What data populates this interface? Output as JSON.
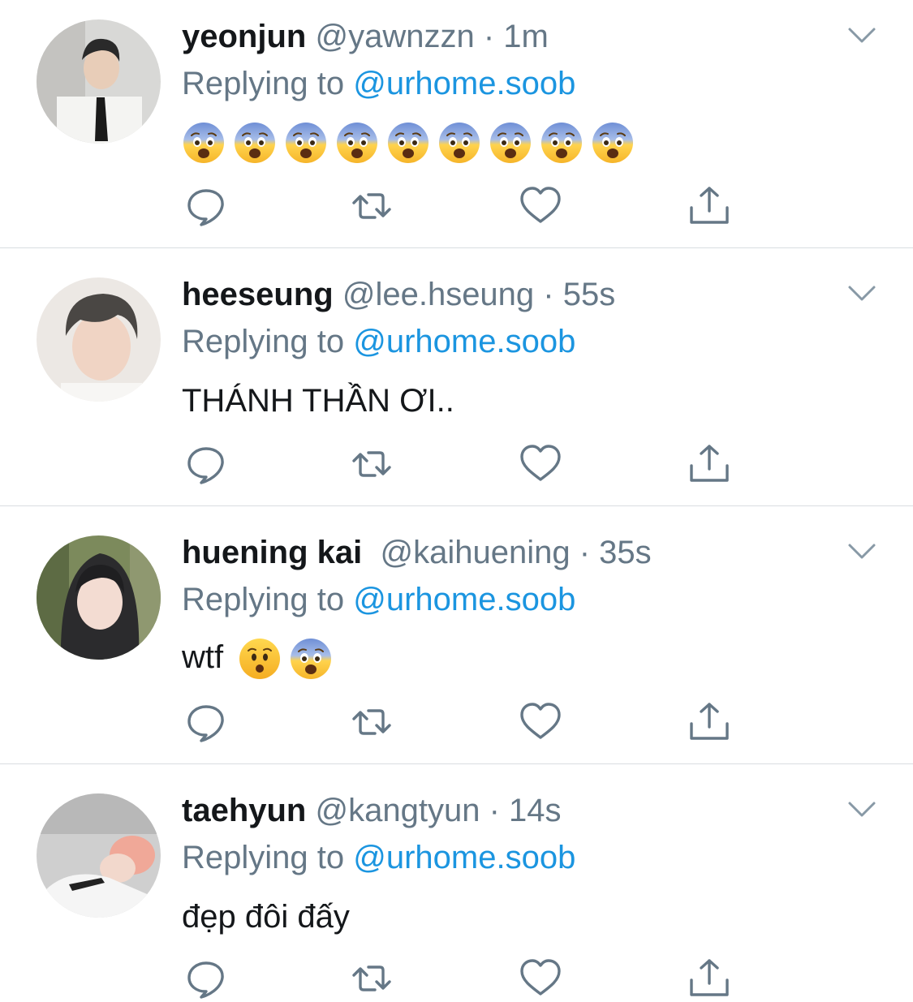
{
  "reply_prefix": "Replying to",
  "tweets": [
    {
      "display_name": "yeonjun",
      "handle": "@yawnzzn",
      "separator": "·",
      "time": "1m",
      "replying_to": "@urhome.soob",
      "text": "",
      "emojis": [
        "fearful-face",
        "fearful-face",
        "fearful-face",
        "fearful-face",
        "fearful-face",
        "fearful-face",
        "fearful-face",
        "fearful-face",
        "fearful-face"
      ]
    },
    {
      "display_name": "heeseung",
      "handle": "@lee.hseung",
      "separator": "·",
      "time": "55s",
      "replying_to": "@urhome.soob",
      "text": "THÁNH THẦN ƠI..",
      "emojis": []
    },
    {
      "display_name": "huening kai",
      "handle": "@kaihuening",
      "separator": "·",
      "time": "35s",
      "replying_to": "@urhome.soob",
      "text": "wtf",
      "emojis": [
        "hushed-face",
        "fearful-face"
      ]
    },
    {
      "display_name": "taehyun",
      "handle": "@kangtyun",
      "separator": "·",
      "time": "14s",
      "replying_to": "@urhome.soob",
      "text": "đẹp đôi đấy",
      "emojis": []
    }
  ],
  "action_icons": [
    "reply-icon",
    "retweet-icon",
    "like-icon",
    "share-icon"
  ],
  "colors": {
    "link": "#1b95e0",
    "secondary_text": "#657786",
    "icon": "#657786",
    "divider": "#d9dde1"
  }
}
